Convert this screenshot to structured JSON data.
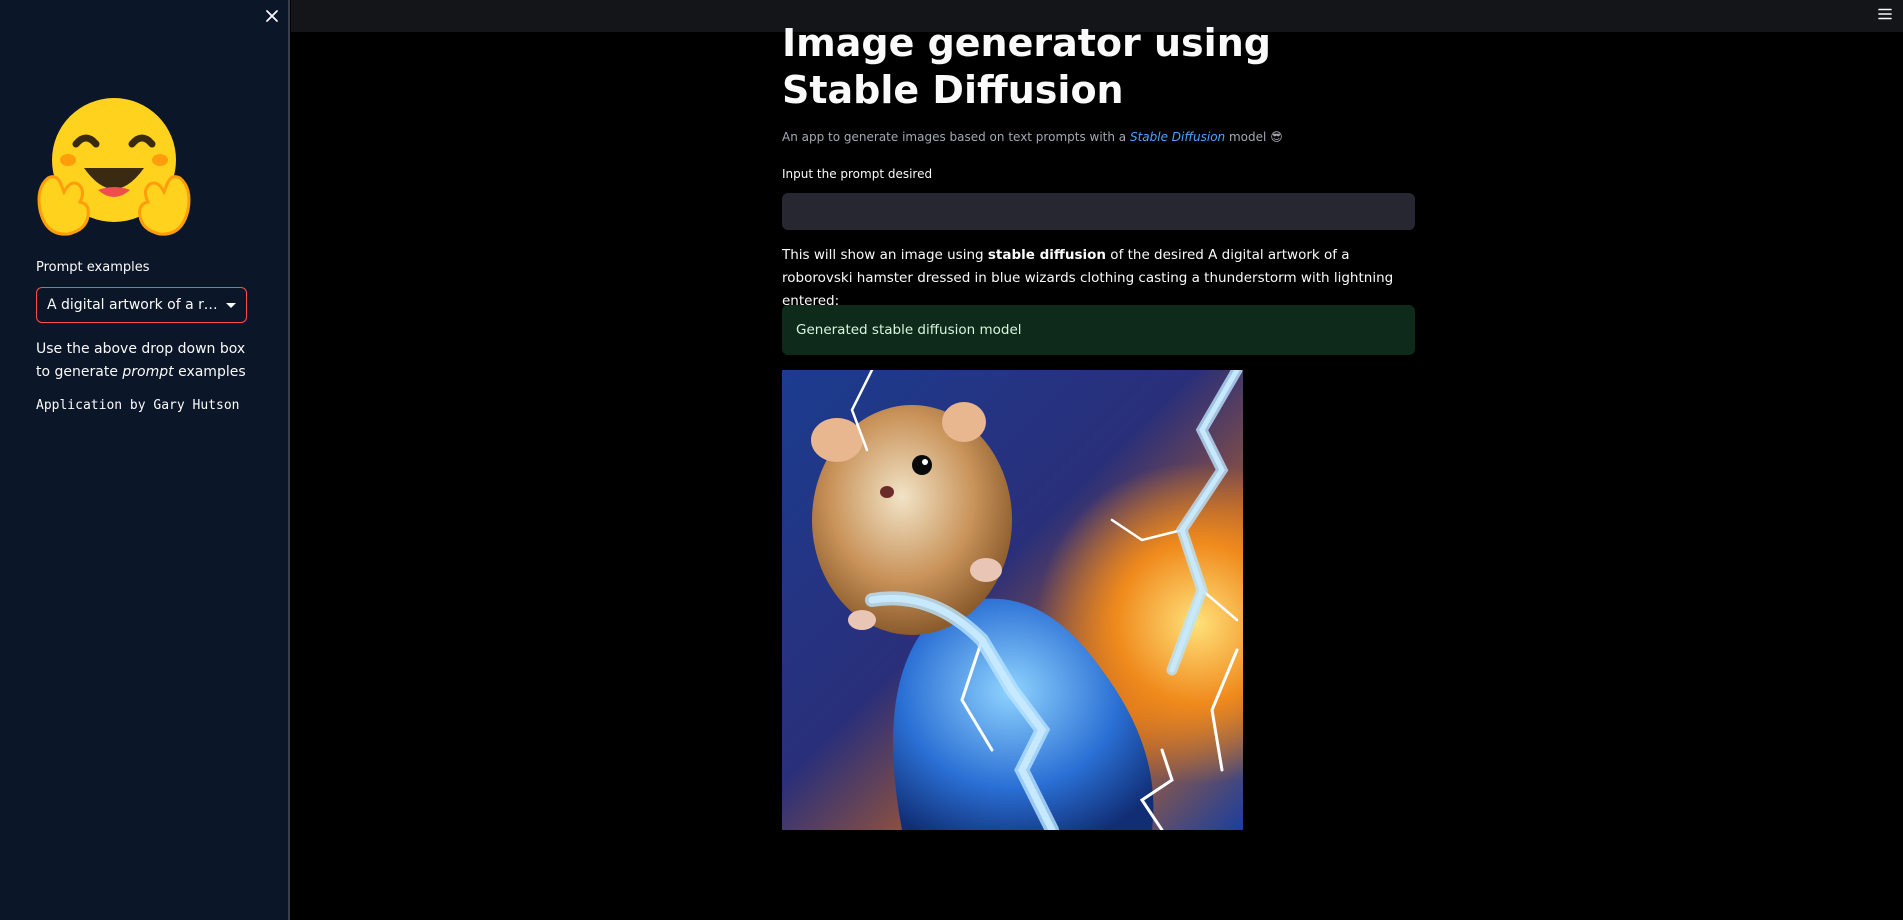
{
  "sidebar": {
    "prompt_label": "Prompt examples",
    "selected_prompt": "A digital artwork of a rob…",
    "help_text_1": "Use the above drop down box to generate ",
    "help_text_em": "prompt",
    "help_text_2": " examples",
    "credit": "Application by Gary Hutson"
  },
  "main": {
    "title": "Image generator using Stable Diffusion",
    "subtitle_prefix": "An app to generate images based on text prompts with a ",
    "subtitle_link": "Stable Diffusion",
    "subtitle_suffix": " model",
    "subtitle_emoji": "😎",
    "input_label": "Input the prompt desired",
    "input_value": "",
    "desc_prefix": "This will show an image using ",
    "desc_bold": "stable diffusion",
    "desc_suffix": " of the desired A digital artwork of a roborovski hamster dressed in blue wizards clothing casting a thunderstorm with lightning entered:",
    "success_text": "Generated stable diffusion model"
  },
  "icons": {
    "close": "close-icon",
    "menu": "hamburger-menu-icon",
    "dropdown": "chevron-down-icon",
    "logo": "hugging-face-emoji-icon"
  },
  "colors": {
    "background": "#000000",
    "sidebar": "#0b1728",
    "accent": "#ff4b4b",
    "link": "#4da3ff",
    "success_bg": "#0e2a1a"
  }
}
